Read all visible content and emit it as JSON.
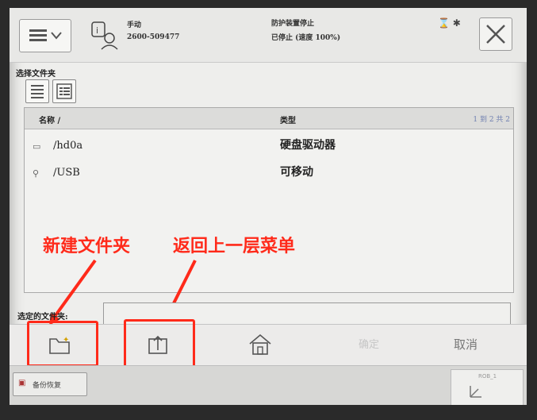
{
  "header": {
    "mode": "手动",
    "controller_id": "2600-509477",
    "status_line1": "防护装置停止",
    "status_line2": "已停止 (速度 100%)"
  },
  "dialog": {
    "title": "选择文件夹",
    "columns": {
      "name": "名称 /",
      "type": "类型"
    },
    "pager": "1 到 2 共 2",
    "rows": [
      {
        "name": "/hd0a",
        "type": "硬盘驱动器",
        "icon": "disk-icon"
      },
      {
        "name": "/USB",
        "type": "可移动",
        "icon": "usb-icon"
      }
    ],
    "selected_label": "选定的文件夹:",
    "selected_value": "",
    "ok_label": "确定",
    "cancel_label": "取消"
  },
  "annotations": {
    "new_folder": "新建文件夹",
    "go_up": "返回上一层菜单",
    "color": "#ff2a1a"
  },
  "taskbar": {
    "backup_tab": "备份恢复",
    "jog_label": "ROB_1"
  }
}
